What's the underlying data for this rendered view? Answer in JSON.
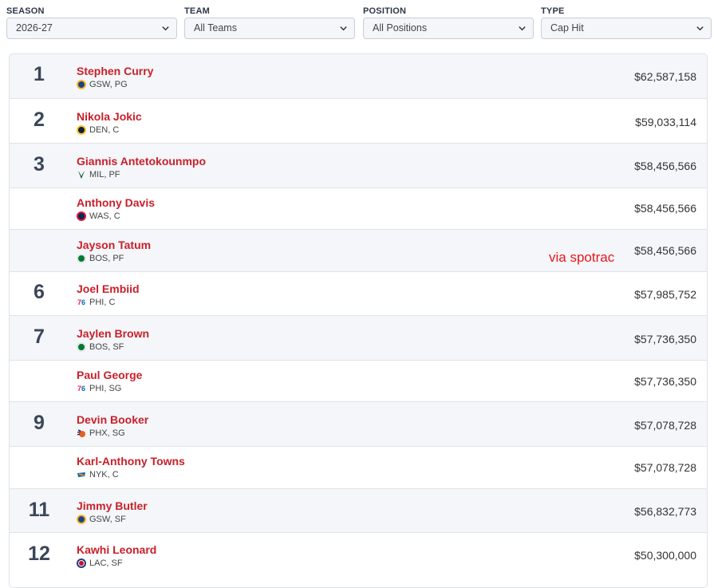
{
  "filters": [
    {
      "label": "SEASON",
      "value": "2026-27"
    },
    {
      "label": "TEAM",
      "value": "All Teams"
    },
    {
      "label": "POSITION",
      "value": "All Positions"
    },
    {
      "label": "TYPE",
      "value": "Cap Hit"
    }
  ],
  "rows": [
    {
      "rank": "1",
      "name": "Stephen Curry",
      "meta": "GSW, PG",
      "salary": "$62,587,158",
      "logo": "warriors-logo"
    },
    {
      "rank": "2",
      "name": "Nikola Jokic",
      "meta": "DEN, C",
      "salary": "$59,033,114",
      "logo": "nuggets-logo"
    },
    {
      "rank": "3",
      "name": "Giannis Antetokounmpo",
      "meta": "MIL, PF",
      "salary": "$58,456,566",
      "logo": "bucks-logo"
    },
    {
      "rank": "",
      "name": "Anthony Davis",
      "meta": "WAS, C",
      "salary": "$58,456,566",
      "logo": "wizards-logo"
    },
    {
      "rank": "",
      "name": "Jayson Tatum",
      "meta": "BOS, PF",
      "salary": "$58,456,566",
      "logo": "celtics-logo"
    },
    {
      "rank": "6",
      "name": "Joel Embiid",
      "meta": "PHI, C",
      "salary": "$57,985,752",
      "logo": "76ers-logo"
    },
    {
      "rank": "7",
      "name": "Jaylen Brown",
      "meta": "BOS, SF",
      "salary": "$57,736,350",
      "logo": "celtics-logo"
    },
    {
      "rank": "",
      "name": "Paul George",
      "meta": "PHI, SG",
      "salary": "$57,736,350",
      "logo": "76ers-logo"
    },
    {
      "rank": "9",
      "name": "Devin Booker",
      "meta": "PHX, SG",
      "salary": "$57,078,728",
      "logo": "suns-logo"
    },
    {
      "rank": "",
      "name": "Karl-Anthony Towns",
      "meta": "NYK, C",
      "salary": "$57,078,728",
      "logo": "knicks-logo"
    },
    {
      "rank": "11",
      "name": "Jimmy Butler",
      "meta": "GSW, SF",
      "salary": "$56,832,773",
      "logo": "warriors-logo"
    },
    {
      "rank": "12",
      "name": "Kawhi Leonard",
      "meta": "LAC, SF",
      "salary": "$50,300,000",
      "logo": "clippers-logo"
    }
  ],
  "watermark": "via spotrac",
  "colors": {
    "player_name": "#c8202a",
    "rank": "#3b4657",
    "row_shade": "#f4f6f9",
    "watermark": "#e8151b"
  }
}
